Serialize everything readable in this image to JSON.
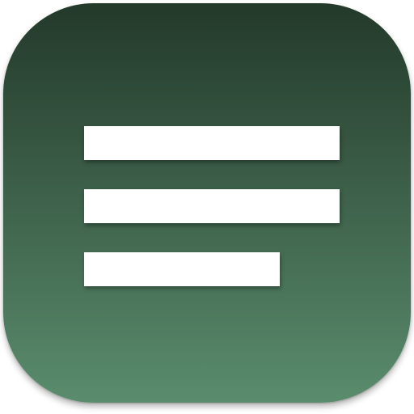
{
  "icon": {
    "name": "text-lines-icon",
    "gradient_top": "#23392a",
    "gradient_bottom": "#5a8c6d",
    "line_color": "#ffffff",
    "line_count": 3
  }
}
